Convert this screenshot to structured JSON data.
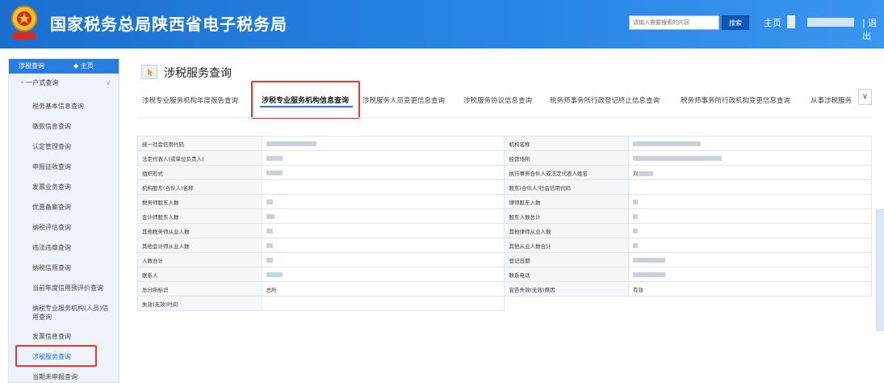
{
  "header": {
    "title": "国家税务总局陕西省电子税务局",
    "search_placeholder": "请输入需要搜索的内容",
    "search_button": "搜索",
    "home": "主页",
    "logout": "| 退出"
  },
  "sidebar": {
    "head": "涉税查询",
    "home": "◆ 主页",
    "group": "一户式查询",
    "items": [
      "税务基本信息查询",
      "缴款信息查询",
      "认定管理查询",
      "申报征收查询",
      "发票业务查询",
      "优惠备案查询",
      "纳税评估查询",
      "违法违章查询",
      "纳税信用查询",
      "当前年度信用预评价查询",
      "纳税专业服务机构(人员)信用查询",
      "发票信息查询",
      "涉税服务查询",
      "当期未申报查询"
    ]
  },
  "main": {
    "title": "涉税服务查询",
    "tabs": [
      "涉税专业服务机构年度报告查询",
      "涉税专业服务机构信息查询",
      "涉税服务人员变更信息查询",
      "涉税服务协议信息查询",
      "税务师事务所行政登记终止信息查询",
      "税务师事务所行政机构变更信息查询",
      "从事涉税服务"
    ],
    "more": "∨"
  },
  "table": {
    "rows": [
      [
        "统一社会信用代码",
        "",
        "机构名称",
        ""
      ],
      [
        "法定代表人(或单位负责人)",
        "",
        "经营场所",
        ""
      ],
      [
        "组织形式",
        "",
        "执行事务合伙人或法定代表人姓名",
        "刘"
      ],
      [
        "机构股东(合伙人)名称",
        "",
        "股东(合伙人)社会信用代码",
        ""
      ],
      [
        "税务师股东人数",
        "",
        "律师股东人数",
        ""
      ],
      [
        "会计师股东人数",
        "",
        "股东人数总计",
        ""
      ],
      [
        "其他税务师从业人数",
        "",
        "其他律师从业人数",
        ""
      ],
      [
        "其他会计师从业人数",
        "",
        "其他从业人数合计",
        ""
      ],
      [
        "人数合计",
        "",
        "登记日期",
        ""
      ],
      [
        "联系人",
        "",
        "联系电话",
        ""
      ],
      [
        "总分所标识",
        "总所",
        "宣告失效(无效)原因",
        "有效"
      ],
      [
        "失效(无效)时间",
        "",
        "",
        ""
      ]
    ]
  }
}
